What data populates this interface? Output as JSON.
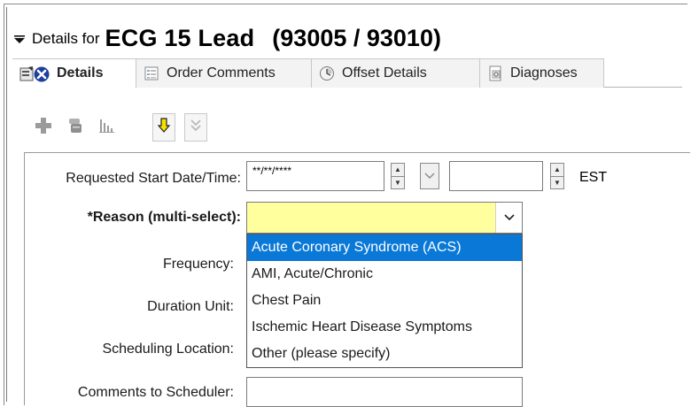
{
  "header": {
    "details_for": "Details for",
    "order_name": "ECG 15 Lead",
    "order_codes": "(93005 / 93010)"
  },
  "tabs": [
    {
      "label": "Details",
      "icon": "details-icon",
      "active": true
    },
    {
      "label": "Order Comments",
      "icon": "comments-icon",
      "active": false
    },
    {
      "label": "Offset Details",
      "icon": "clock-icon",
      "active": false
    },
    {
      "label": "Diagnoses",
      "icon": "diagnoses-icon",
      "active": false
    }
  ],
  "toolbar": {
    "buttons": [
      "add-icon",
      "copy-icon",
      "chart-icon",
      "move-down-icon",
      "move-all-down-icon"
    ]
  },
  "form": {
    "start_label": "Requested Start Date/Time:",
    "start_date_value": "**/**/****",
    "start_time_value": "",
    "timezone": "EST",
    "reason_label": "*Reason (multi-select):",
    "reason_value": "",
    "frequency_label": "Frequency:",
    "duration_label": "Duration Unit:",
    "scheduling_label": "Scheduling Location:",
    "comments_label": "Comments to Scheduler:"
  },
  "reason_options": [
    "Acute Coronary Syndrome (ACS)",
    "AMI, Acute/Chronic",
    "Chest Pain",
    "Ischemic Heart Disease Symptoms",
    "Other (please specify)"
  ],
  "reason_highlighted": 0,
  "colors": {
    "required_field_bg": "#ffff9e",
    "selection_bg": "#0a78d7"
  }
}
